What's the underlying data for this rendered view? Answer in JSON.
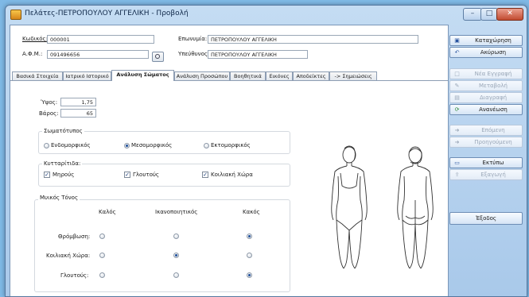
{
  "window": {
    "title": "Πελάτες-ΠΕΤΡΟΠΟΥΛΟΥ ΑΓΓΕΛΙΚΗ - Προβολή",
    "controls": {
      "minimize": "–",
      "maximize": "□",
      "close": "✕"
    }
  },
  "header": {
    "code_label": "Κωδικός:",
    "code_value": "000001",
    "name_label": "Επωνυμία:",
    "name_value": "ΠΕΤΡΟΠΟΥΛΟΥ ΑΓΓΕΛΙΚΗ",
    "afm_label": "Α.Φ.Μ.:",
    "afm_value": "091496656",
    "responsible_label": "Υπεύθυνος:",
    "responsible_value": "ΠΕΤΡΟΠΟΥΛΟΥ ΑΓΓΕΛΙΚΗ"
  },
  "tabs": [
    {
      "label": "Βασικά Στοιχεία"
    },
    {
      "label": "Ιατρικό Ιστορικό"
    },
    {
      "label": "Ανάλυση Σώματος"
    },
    {
      "label": "Ανάλυση Προσώπου"
    },
    {
      "label": "Βοηθητικά"
    },
    {
      "label": "Εικόνες"
    },
    {
      "label": "Αποδείκτες"
    },
    {
      "label": "-> Σημειώσεις"
    }
  ],
  "active_tab": "Ανάλυση Σώματος",
  "body": {
    "height_label": "Ύψος:",
    "height_value": "1,75",
    "weight_label": "Βάρος:",
    "weight_value": "65",
    "somatotype": {
      "title": "Σωματότυπος",
      "options": [
        "Ενδομορφικός",
        "Μεσομορφικός",
        "Εκτομορφικός"
      ],
      "selected": "Μεσομορφικός"
    },
    "cellulite": {
      "title": "Κυτταρίτιδα:",
      "items": [
        {
          "label": "Μηρούς",
          "checked": true
        },
        {
          "label": "Γλουτούς",
          "checked": true
        },
        {
          "label": "Κοιλιακή Χώρα",
          "checked": true
        }
      ]
    },
    "muscle_tone": {
      "title": "Μυικός Τόνος",
      "columns": [
        "Καλός",
        "Ικανοποιητικός",
        "Κακός"
      ],
      "rows": [
        {
          "label": "Θρόμβωση:",
          "selected": "Κακός"
        },
        {
          "label": "Κοιλιακή Χώρα:",
          "selected": "Ικανοποιητικός"
        },
        {
          "label": "Γλουτούς:",
          "selected": "Κακός"
        }
      ]
    }
  },
  "sidebar": {
    "buttons": [
      {
        "label": "Καταχώρηση",
        "icon": "save-icon",
        "enabled": true
      },
      {
        "label": "Ακύρωση",
        "icon": "undo-icon",
        "enabled": true
      },
      {
        "label": "Νέα Εγγραφή",
        "icon": "new-record-icon",
        "enabled": false
      },
      {
        "label": "Μεταβολή",
        "icon": "edit-icon",
        "enabled": false
      },
      {
        "label": "Διαγραφή",
        "icon": "delete-icon",
        "enabled": false
      },
      {
        "label": "Ανανέωση",
        "icon": "refresh-icon",
        "enabled": true
      },
      {
        "label": "Επόμενη",
        "icon": "next-icon",
        "enabled": false
      },
      {
        "label": "Προηγούμενη",
        "icon": "previous-icon",
        "enabled": false
      },
      {
        "label": "Εκτύπω",
        "icon": "print-icon",
        "enabled": true
      },
      {
        "label": "Εξαγωγή",
        "icon": "export-icon",
        "enabled": false
      },
      {
        "label": "Έξοδος",
        "icon": "",
        "enabled": true
      }
    ]
  }
}
